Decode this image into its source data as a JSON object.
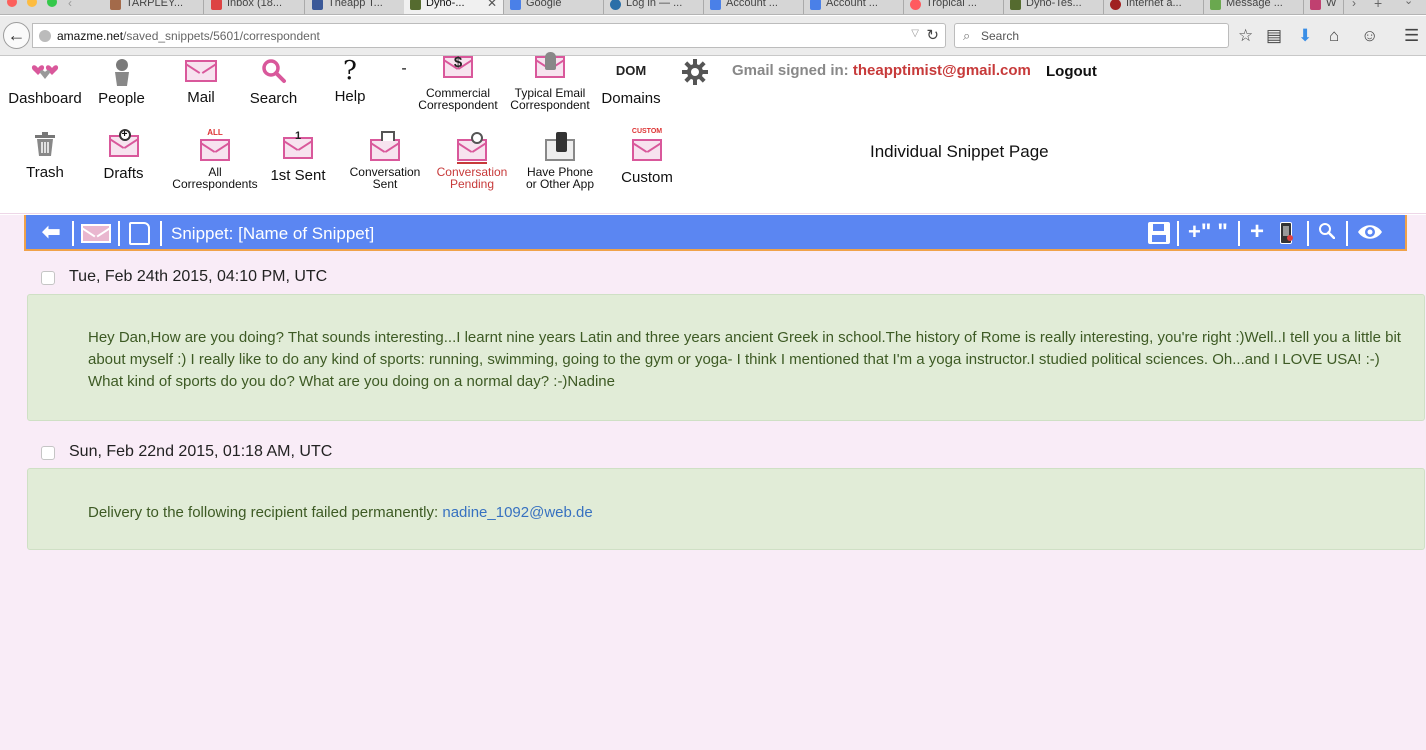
{
  "browser": {
    "tabs": [
      {
        "label": "TARPLEY...",
        "active": false
      },
      {
        "label": "Inbox (18...",
        "active": false
      },
      {
        "label": "Theapp T...",
        "active": false
      },
      {
        "label": "Dyno-...",
        "active": true
      },
      {
        "label": "Google",
        "active": false
      },
      {
        "label": "Log in — ...",
        "active": false
      },
      {
        "label": "Account ...",
        "active": false
      },
      {
        "label": "Account ...",
        "active": false
      },
      {
        "label": "Tropical ...",
        "active": false
      },
      {
        "label": "Dyno-Tes...",
        "active": false
      },
      {
        "label": "Internet a...",
        "active": false
      },
      {
        "label": "Message ...",
        "active": false
      },
      {
        "label": "W",
        "active": false
      }
    ],
    "url_domain": "amazme.net",
    "url_path": "/saved_snippets/5601/correspondent",
    "search_placeholder": "Search"
  },
  "nav_row1": [
    {
      "key": "dashboard",
      "label": "Dashboard"
    },
    {
      "key": "people",
      "label": "People"
    },
    {
      "key": "mail",
      "label": "Mail"
    },
    {
      "key": "search",
      "label": "Search"
    },
    {
      "key": "help",
      "label": "Help"
    },
    {
      "key": "dash",
      "label": "-"
    },
    {
      "key": "commercial",
      "label_line1": "Commercial",
      "label_line2": "Correspondent",
      "icon_text": "$"
    },
    {
      "key": "typical",
      "label_line1": "Typical Email",
      "label_line2": "Correspondent"
    },
    {
      "key": "domains",
      "label": "Domains",
      "icon_text": "DOM"
    }
  ],
  "nav_row2": [
    {
      "key": "trash",
      "label": "Trash"
    },
    {
      "key": "drafts",
      "label": "Drafts"
    },
    {
      "key": "all",
      "label_line1": "All",
      "label_line2": "Correspondents",
      "icon_text": "ALL"
    },
    {
      "key": "first_sent",
      "label": "1st Sent",
      "icon_text": "1"
    },
    {
      "key": "conv_sent",
      "label_line1": "Conversation",
      "label_line2": "Sent"
    },
    {
      "key": "conv_pending",
      "label_line1": "Conversation",
      "label_line2": "Pending"
    },
    {
      "key": "phone",
      "label_line1": "Have Phone",
      "label_line2": "or Other App"
    },
    {
      "key": "custom",
      "label": "Custom",
      "icon_text": "CUSTOM"
    }
  ],
  "account": {
    "signed_in_label": "Gmail signed in:",
    "email": "theapptimist@gmail.com",
    "logout_label": "Logout"
  },
  "page_title": "Individual Snippet Page",
  "snippet_bar": {
    "title": "Snippet: [Name of Snippet]",
    "add_quote_label": "+\" \"",
    "add_label": "+"
  },
  "messages": [
    {
      "date": "Tue, Feb 24th 2015, 04:10 PM, UTC",
      "body": "Hey Dan,How are you doing? That sounds interesting...I learnt nine years Latin and three years ancient Greek in school.The history of Rome is really interesting, you're right :)Well..I tell you a little bit about myself :) I really like to do any kind of sports: running, swimming, going to the gym or yoga- I think I mentioned that I'm a yoga instructor.I studied political sciences. Oh...and I LOVE USA! :-) What kind of sports do you do? What are you doing on a normal day? :-)Nadine"
    },
    {
      "date": "Sun, Feb 22nd 2015, 01:18 AM, UTC",
      "body_prefix": "Delivery to the following recipient failed permanently:",
      "link": "nadine_1092@web.de"
    }
  ],
  "colors": {
    "accent_pink": "#d9589b",
    "red_text": "#c73a3a",
    "toolbar_blue": "#5b86f2",
    "toolbar_border": "#f0a24a",
    "message_bg": "#e1ecd7",
    "message_text": "#3d5a24",
    "page_bg": "#f9ecf7"
  }
}
